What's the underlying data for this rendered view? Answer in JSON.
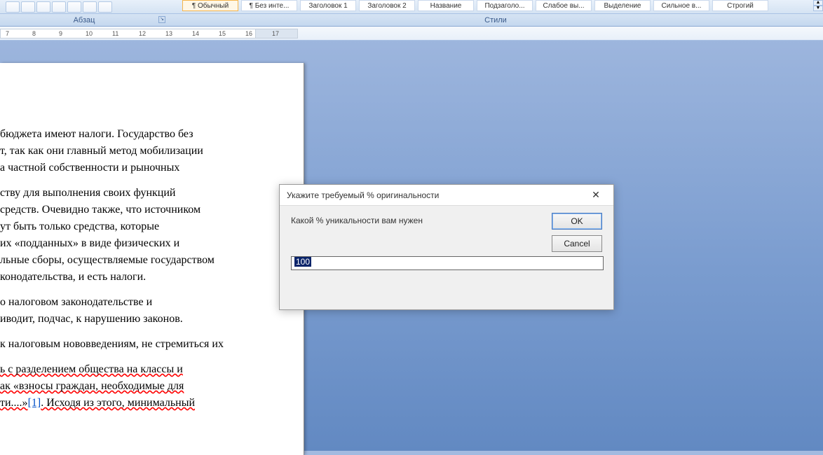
{
  "ribbon": {
    "paragraph_label": "Абзац",
    "styles_label": "Стили",
    "styles": [
      {
        "label": "¶ Обычный",
        "active": true
      },
      {
        "label": "¶ Без инте..."
      },
      {
        "label": "Заголовок 1"
      },
      {
        "label": "Заголовок 2"
      },
      {
        "label": "Название"
      },
      {
        "label": "Подзаголо..."
      },
      {
        "label": "Слабое вы..."
      },
      {
        "label": "Выделение"
      },
      {
        "label": "Сильное в..."
      },
      {
        "label": "Строгий"
      }
    ]
  },
  "ruler": {
    "ticks": [
      "7",
      "8",
      "9",
      "10",
      "11",
      "12",
      "13",
      "14",
      "15",
      "16",
      "17"
    ],
    "start": 8,
    "step": 38
  },
  "document": {
    "p1": " бюджета имеют налоги. Государство без",
    "p2": "т, так как они главный метод мобилизации",
    "p3": "а частной собственности и рыночных",
    "p4": "ству для выполнения своих функций",
    "p5": " средств. Очевидно также, что источником",
    "p6": "ут быть только средства, которые",
    "p7": "их «подданных» в виде физических и",
    "p8": "льные сборы, осуществляемые государством",
    "p9": "конодательства, и есть налоги.",
    "p10": " о налоговом законодательстве и",
    "p11": "иводит, подчас, к нарушению законов.",
    "p12": "к налоговым нововведениям, не стремиться их",
    "p13a": "ь с разделением общества на классы и",
    "p13b": "ак «взносы граждан, необходимые для",
    "p13c_pre": "ти....»",
    "p13c_link": "[1]",
    "p13c_post": ". Исходя из этого, минимальный"
  },
  "dialog": {
    "title": "Укажите требуемый % оригинальности",
    "message": "Какой % уникальности вам нужен",
    "ok": "OK",
    "cancel": "Cancel",
    "value": "100"
  }
}
